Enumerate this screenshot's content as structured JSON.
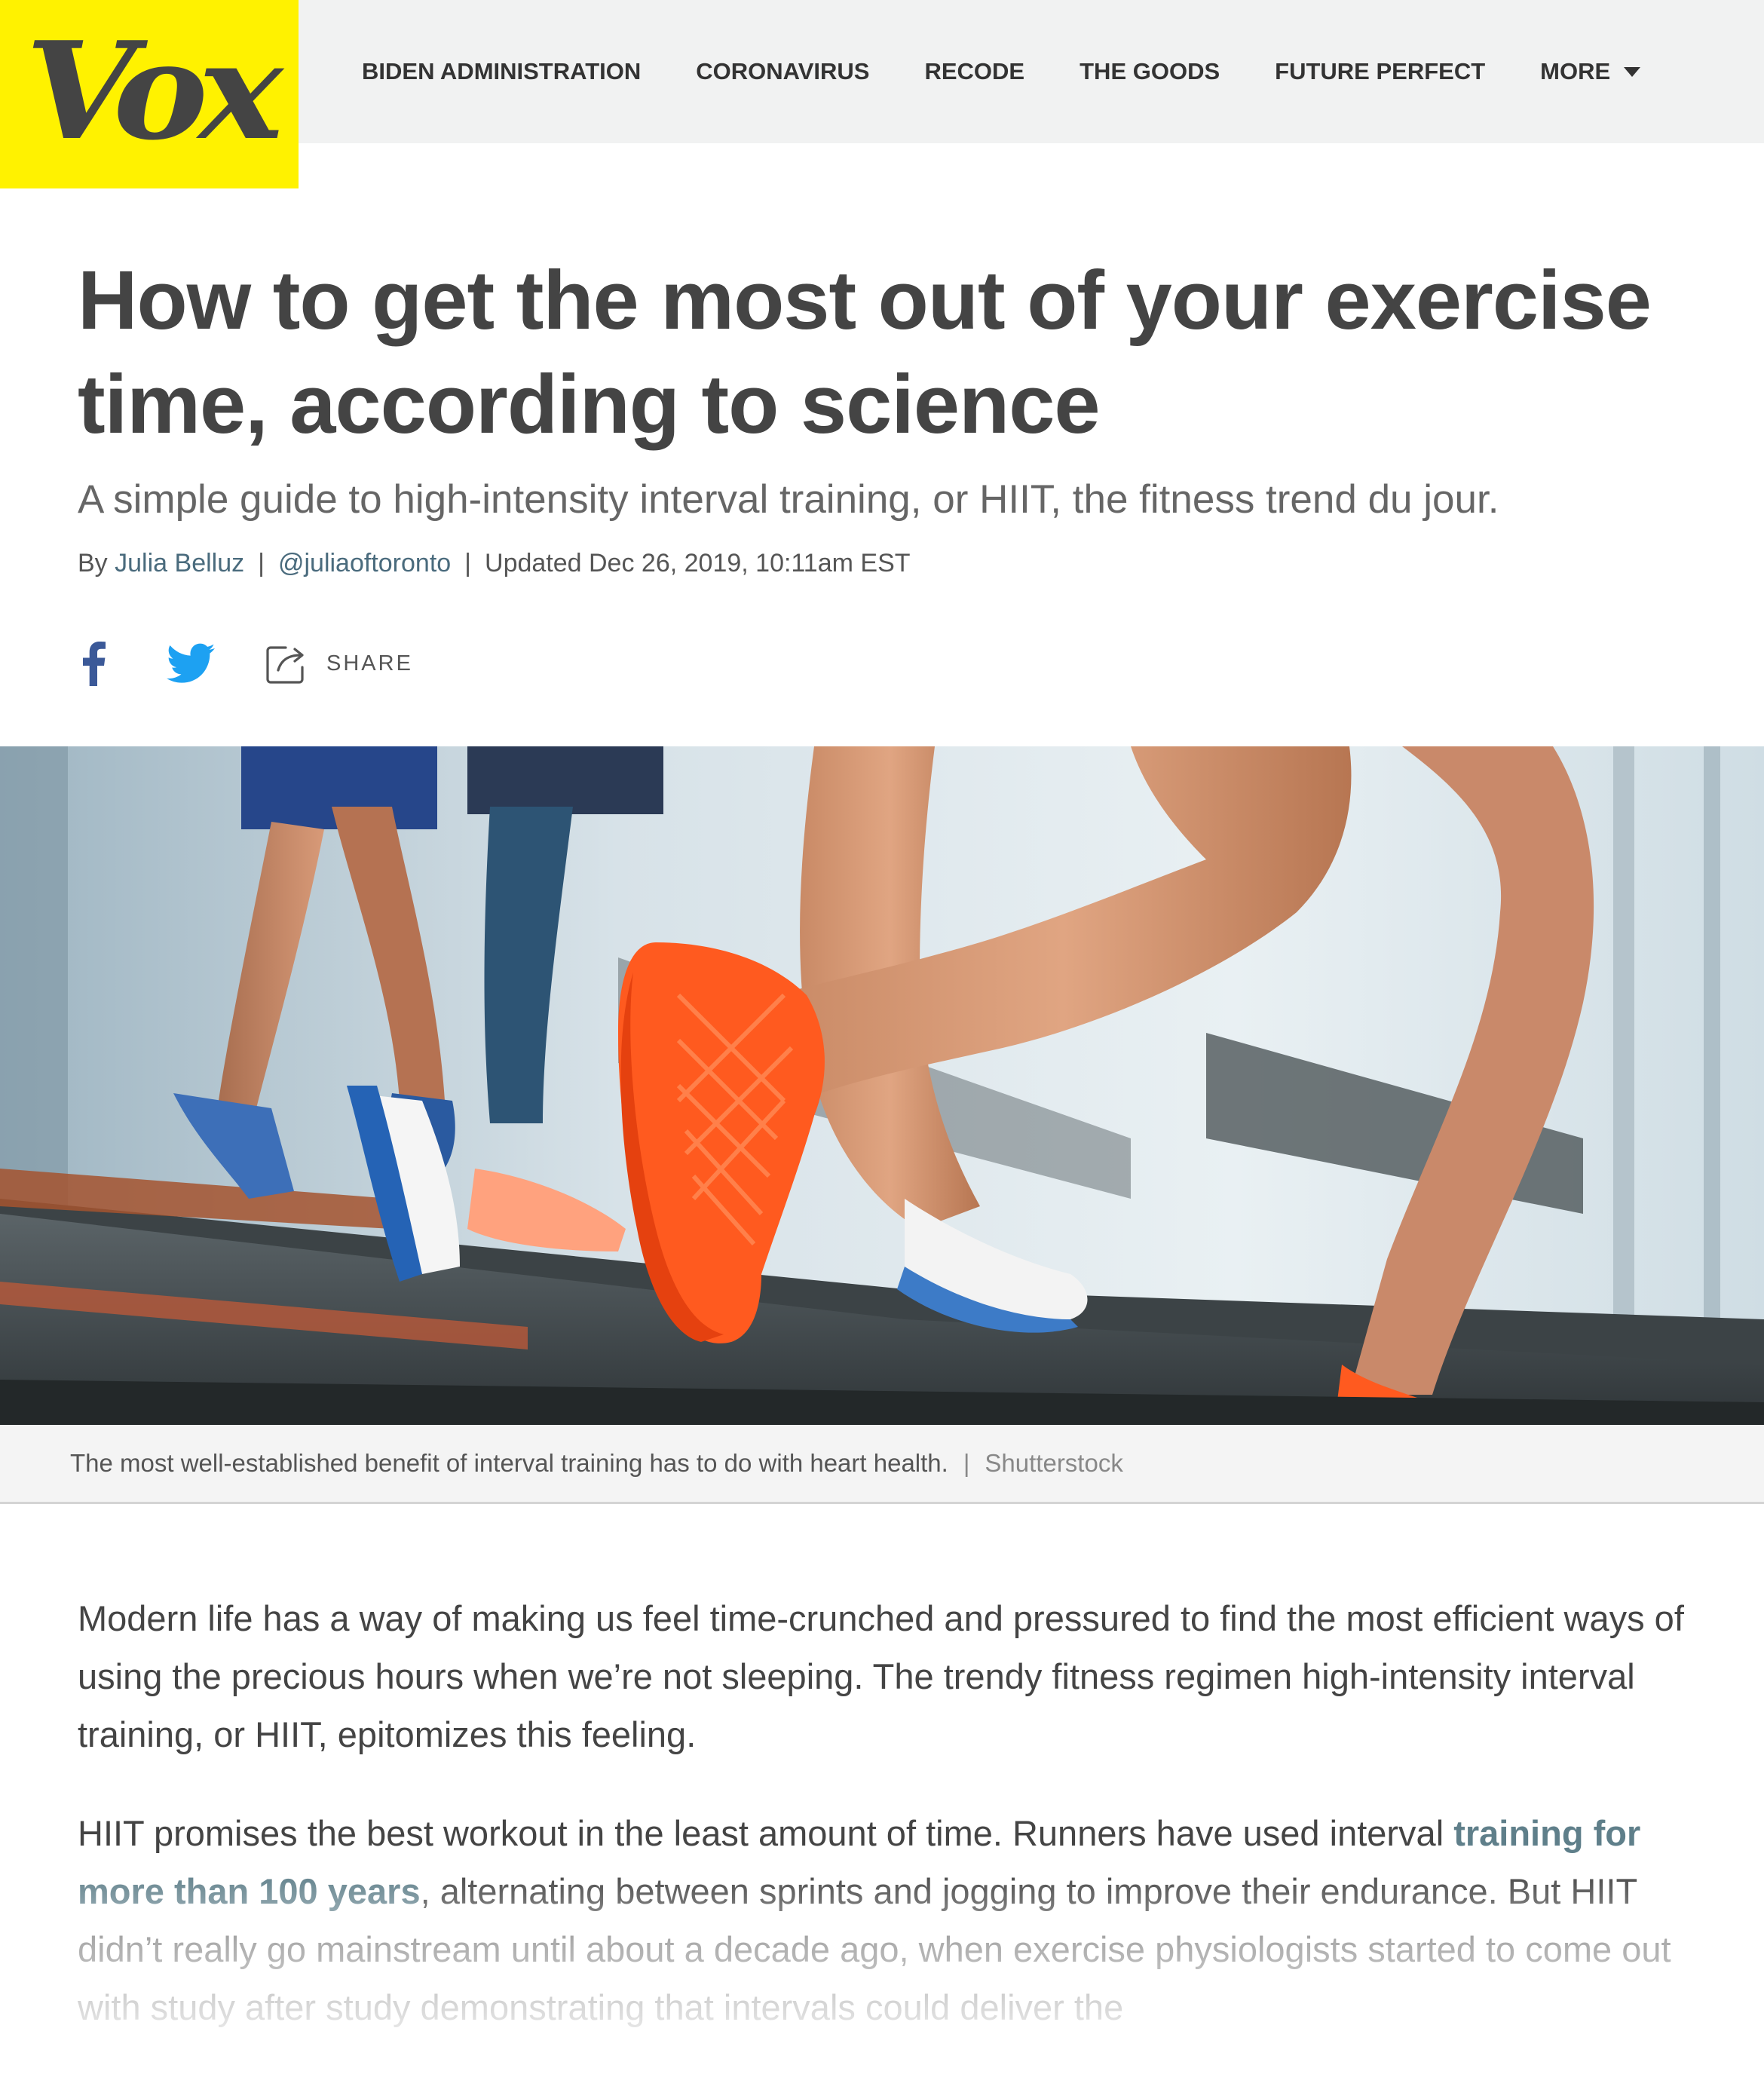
{
  "header": {
    "logo": "Vox",
    "nav": [
      {
        "label": "BIDEN ADMINISTRATION"
      },
      {
        "label": "CORONAVIRUS"
      },
      {
        "label": "RECODE"
      },
      {
        "label": "THE GOODS"
      },
      {
        "label": "FUTURE PERFECT"
      },
      {
        "label": "MORE"
      }
    ]
  },
  "article": {
    "title": "How to get the most out of your exercise time, according to science",
    "dek": "A simple guide to high-intensity interval training, or HIIT, the fitness trend du jour.",
    "byline": {
      "by": "By",
      "author": "Julia Belluz",
      "handle": "@juliaoftoronto",
      "updated": "Updated Dec 26, 2019, 10:11am EST"
    },
    "share_label": "SHARE",
    "image": {
      "caption": "The most well-established benefit of interval training has to do with heart health.",
      "credit": "Shutterstock"
    },
    "paragraphs": [
      {
        "text": "Modern life has a way of making us feel time-crunched and pressured to find the most efficient ways of using the precious hours when we’re not sleeping. The trendy fitness regimen high-intensity interval training, or HIIT, epitomizes this feeling."
      },
      {
        "before": "HIIT promises the best workout in the least amount of time. Runners have used interval ",
        "link": "training for more than 100 years",
        "after": ", alternating between sprints and jogging to improve their endurance. But HIIT didn’t really go mainstream until about a decade ago, when exercise physiologists started to come out with study after study demonstrating that intervals could deliver the"
      }
    ]
  },
  "colors": {
    "logo_bg": "#fff200",
    "topbar_bg": "#f1f2f2",
    "link": "#4a6b7d",
    "facebook": "#3b5998",
    "twitter": "#1da1f2",
    "shoe": "#ff5a1f"
  }
}
